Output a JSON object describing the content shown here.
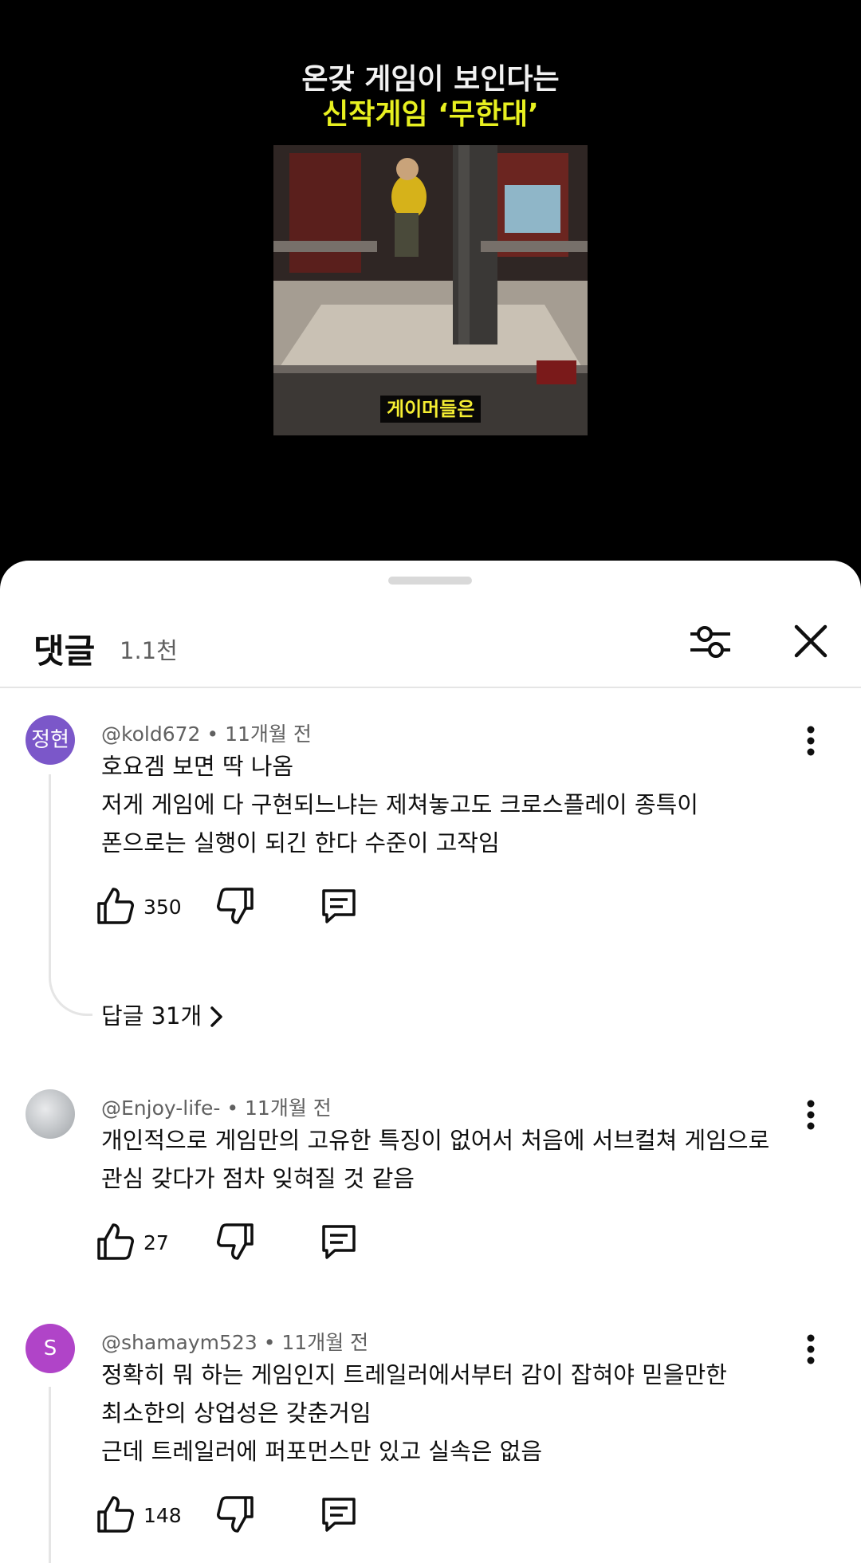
{
  "video": {
    "title_line1": "온갖 게임이 보인다는",
    "title_line2": "신작게임 ‘무한대’",
    "caption": "게이머들은"
  },
  "comments_panel": {
    "title": "댓글",
    "count": "1.1천",
    "filter_icon": "filter-sliders-icon",
    "close_icon": "close-icon"
  },
  "comments": [
    {
      "avatar_text": "정현",
      "avatar_color": "#7b57c9",
      "author": "@kold672",
      "time": "11개월 전",
      "lines": [
        "호요겜 보면 딱 나옴",
        "저게 게임에 다 구현되느냐는 제쳐놓고도 크로스플레이 종특이",
        "폰으로는 실행이 되긴 한다 수준이 고작임"
      ],
      "likes": "350",
      "replies_label": "답글 31개"
    },
    {
      "avatar_text": "",
      "avatar_color": "#b9bdc1",
      "author": "@Enjoy-life-",
      "time": "11개월 전",
      "lines": [
        "개인적으로 게임만의 고유한 특징이 없어서 처음에 서브컬쳐 게임으로",
        "관심 갖다가 점차 잊혀질 것 같음"
      ],
      "likes": "27"
    },
    {
      "avatar_text": "S",
      "avatar_color": "#b044c8",
      "author": "@shamaym523",
      "time": "11개월 전",
      "lines": [
        "정확히 뭐 하는 게임인지 트레일러에서부터 감이 잡혀야 믿을만한",
        "최소한의 상업성은 갖춘거임",
        "근데 트레일러에 퍼포먼스만 있고 실속은 없음"
      ],
      "likes": "148"
    }
  ]
}
